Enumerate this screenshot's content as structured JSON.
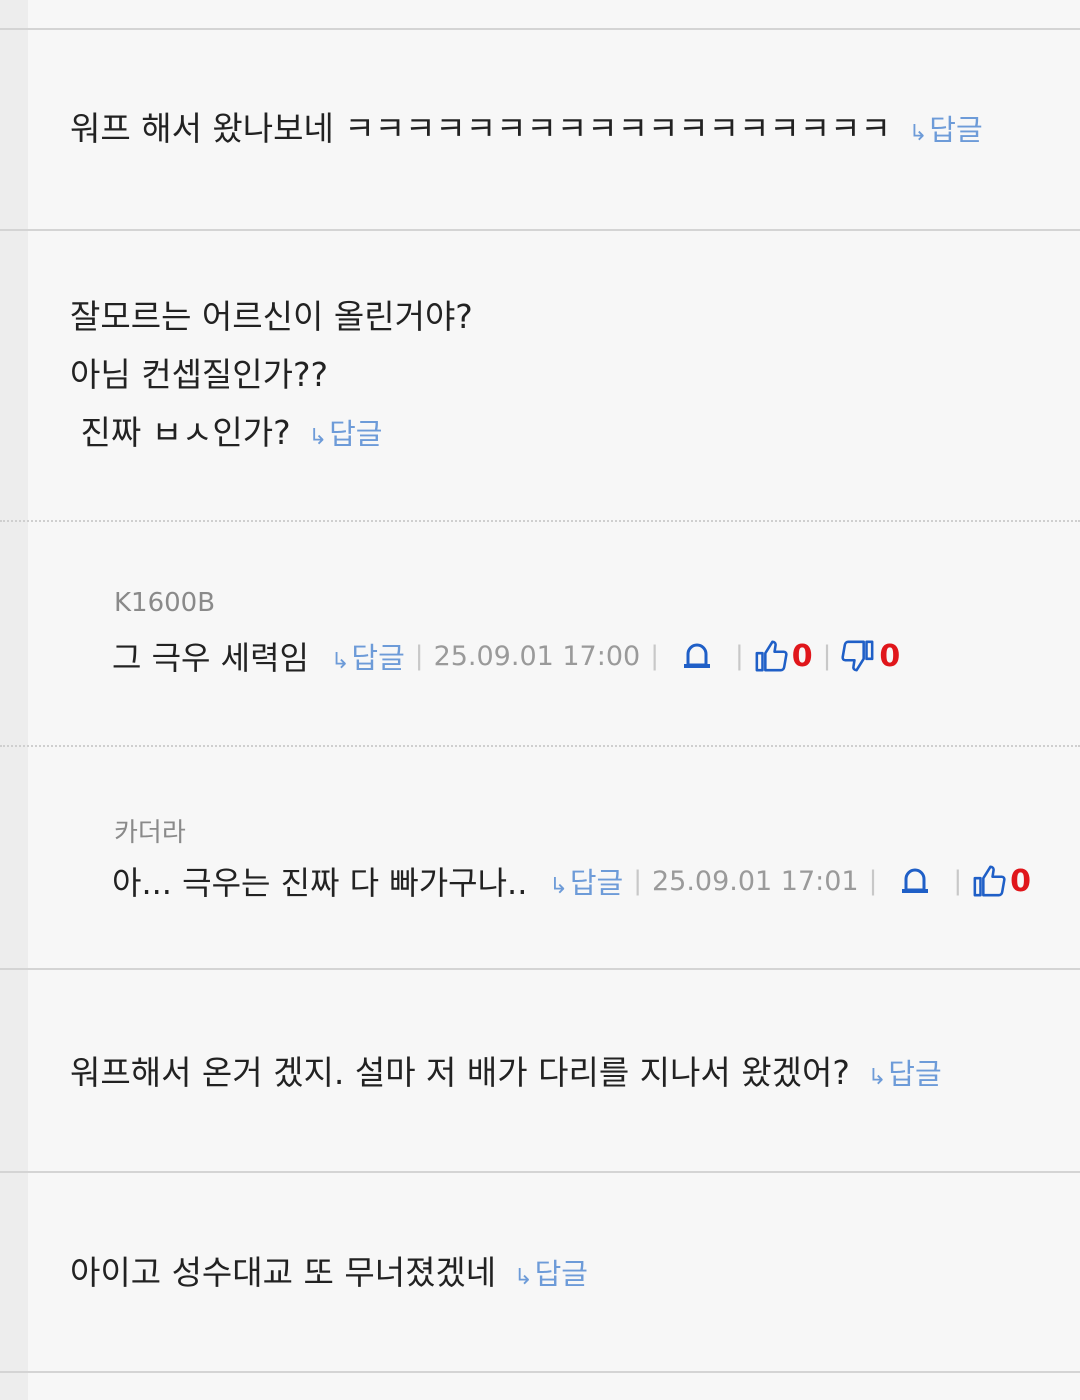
{
  "comments": [
    {
      "text": "워프 해서 왔나보네 ㅋㅋㅋㅋㅋㅋㅋㅋㅋㅋㅋㅋㅋㅋㅋㅋㅋㅋ",
      "reply_label": "답글"
    },
    {
      "lines": [
        "잘모르는 어르신이 올린거야?",
        "아님 컨셉질인가??",
        " 진짜 ㅂㅅ인가?"
      ],
      "reply_label": "답글"
    },
    {
      "text": "워프해서 온거 겠지. 설마 저 배가 다리를 지나서 왔겠어?",
      "reply_label": "답글"
    },
    {
      "text": "아이고 성수대교 또 무너졌겠네",
      "reply_label": "답글"
    }
  ],
  "replies": [
    {
      "nickname": "K1600B",
      "text": "그 극우 세력임",
      "reply_label": "답글",
      "date": "25.09.01 17:00",
      "likes": "0",
      "dislikes": "0"
    },
    {
      "nickname": "카더라",
      "text": "아... 극우는 진짜 다 빠가구나..",
      "reply_label": "답글",
      "date": "25.09.01 17:01",
      "likes": "0"
    }
  ],
  "icons": {
    "reply": "reply-arrow-icon",
    "report": "siren-icon",
    "like": "thumbs-up-icon",
    "dislike": "thumbs-down-icon"
  },
  "colors": {
    "link": "#6d9bd8",
    "vote_count": "#e0161b",
    "icon_blue": "#1f5fc7"
  }
}
